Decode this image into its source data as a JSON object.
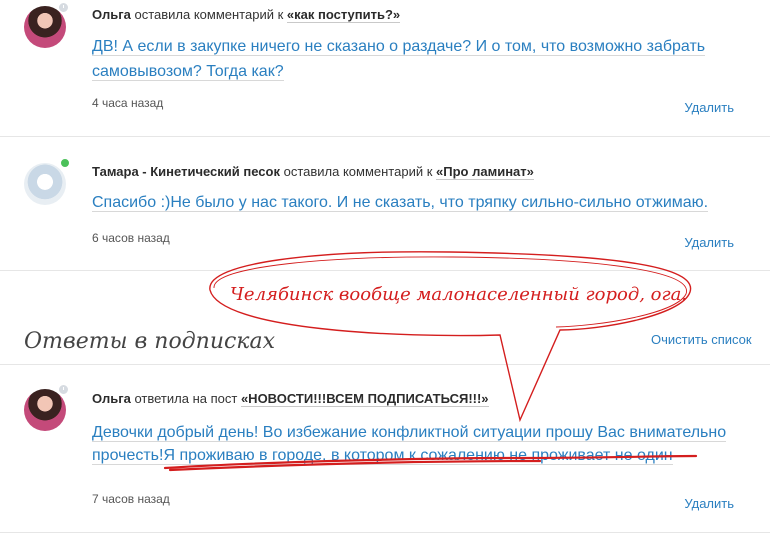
{
  "notifications": [
    {
      "author": "Ольга",
      "action": "оставила комментарий к",
      "post": "«как поступить?»",
      "body": "ДВ! А если в закупке ничего не сказано о раздаче? И о том, что возможно забрать самовывозом? Тогда как?",
      "time": "4 часа назад",
      "delete_label": "Удалить"
    },
    {
      "author": "Тамара - Кинетический песок",
      "action": "оставила комментарий к",
      "post": "«Про ламинат»",
      "body": "Спасибо :)Не было у нас такого. И не сказать, что тряпку сильно-сильно отжимаю.",
      "time": "6 часов назад",
      "delete_label": "Удалить"
    }
  ],
  "subscriptions": {
    "title": "Ответы в подписках",
    "clear_label": "Очистить список",
    "items": [
      {
        "author": "Ольга",
        "action": "ответила на пост",
        "post": "«НОВОСТИ!!!ВСЕМ ПОДПИСАТЬСЯ!!!»",
        "body_line1": "Девочки добрый день! Во избежание конфликтной ситуации прошу Вас внимательно",
        "body_line2": "прочесть!Я проживаю в городе, в котором к сожалению не проживает не один",
        "time": "7 часов назад",
        "delete_label": "Удалить"
      }
    ]
  },
  "annotation": {
    "text": "Челябинск вообще  малонаселенный город, ога.",
    "color": "#d41e1e"
  },
  "colors": {
    "link": "#2a7fc0",
    "online": "#4cc15a"
  }
}
